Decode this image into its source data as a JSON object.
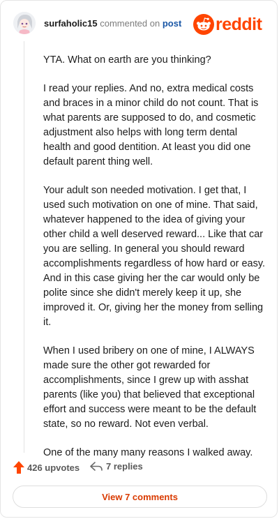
{
  "header": {
    "username": "surfaholic15",
    "action": "commented on",
    "post_link": "post",
    "brand": "reddit"
  },
  "comment": {
    "paragraphs": [
      "YTA. What on earth are you thinking?",
      "I read your replies. And no, extra medical costs and braces in a minor child do not count. That is what parents are supposed to do, and cosmetic adjustment also helps with long term dental health and good dentition. At least you did one default parent thing well.",
      "Your adult son needed motivation. I get that, I used such motivation on one of mine. That said, whatever happened to the idea of giving your other child a well deserved reward... Like that car you are selling. In general you should reward accomplishments regardless of how hard or easy. And in this case giving her the car would only be polite since she didn't merely keep it up, she improved it. Or, giving her the money from selling it.",
      "When I used bribery on one of mine, I ALWAYS made sure the other got rewarded for accomplishments, since I grew up with asshat parents (like you) that believed that exceptional effort and success were meant to be the default state, so no reward. Not even verbal.",
      "One of the many many reasons I walked away."
    ]
  },
  "footer": {
    "upvotes_label": "426 upvotes",
    "replies_label": "7 replies"
  },
  "view_button_label": "View 7 comments",
  "colors": {
    "brand": "#ff4500",
    "link": "#1a57a6",
    "view_button_text": "#d93a00"
  },
  "icons": {
    "avatar": "avatar",
    "logo": "reddit-snoo-icon",
    "upvote": "upvote-arrow-icon",
    "reply": "reply-arrow-icon"
  }
}
